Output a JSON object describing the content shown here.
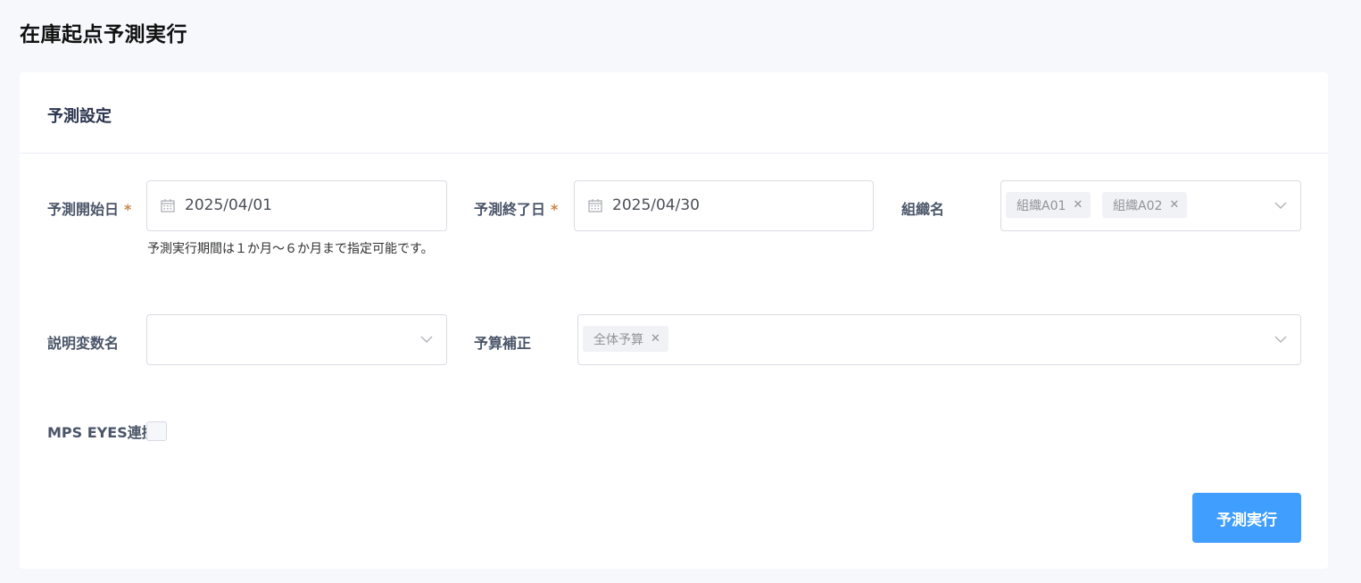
{
  "page": {
    "title": "在庫起点予測実行"
  },
  "card": {
    "title": "予測設定"
  },
  "form": {
    "start_date": {
      "label": "予測開始日",
      "required_mark": "*",
      "value": "2025/04/01",
      "icon": "calendar-icon"
    },
    "hint": "予測実行期間は１か月〜６か月まで指定可能です。",
    "end_date": {
      "label": "予測終了日",
      "required_mark": "*",
      "value": "2025/04/30",
      "icon": "calendar-icon"
    },
    "organization": {
      "label": "組織名",
      "tags": [
        "組織A01",
        "組織A02"
      ],
      "icon": "chevron-down-icon"
    },
    "variable": {
      "label": "説明変数名",
      "value": "",
      "icon": "chevron-down-icon"
    },
    "budget": {
      "label": "予算補正",
      "tags": [
        "全体予算"
      ],
      "icon": "chevron-down-icon"
    },
    "mps_eyes": {
      "label": "MPS EYES連携",
      "checked": false
    }
  },
  "actions": {
    "execute_label": "予測実行"
  },
  "colors": {
    "primary": "#409eff",
    "required": "#c8874a",
    "page_bg": "#f7f8fc"
  }
}
